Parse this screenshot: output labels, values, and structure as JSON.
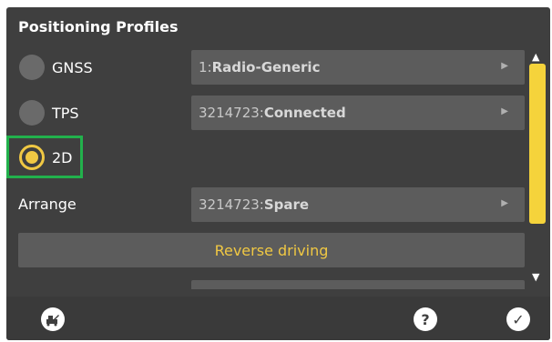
{
  "header": {
    "title": "Positioning Profiles"
  },
  "radios": [
    {
      "label": "GNSS",
      "selected": false
    },
    {
      "label": "TPS",
      "selected": false
    },
    {
      "label": "2D",
      "selected": true
    }
  ],
  "dropdowns": {
    "gnss": {
      "prefix": "1:",
      "value": "Radio-Generic"
    },
    "tps": {
      "prefix": "3214723:",
      "value": "Connected"
    },
    "arrange": {
      "label": "Arrange",
      "prefix": "3214723:",
      "value": "Spare"
    }
  },
  "actions": {
    "reverse_driving": "Reverse driving"
  },
  "colors": {
    "accent": "#f0c843",
    "highlight": "#22b14c",
    "panel": "#3f3f3f"
  },
  "footer_icons": {
    "left": "machine-icon",
    "help": "help-icon",
    "confirm": "checkmark-icon"
  }
}
